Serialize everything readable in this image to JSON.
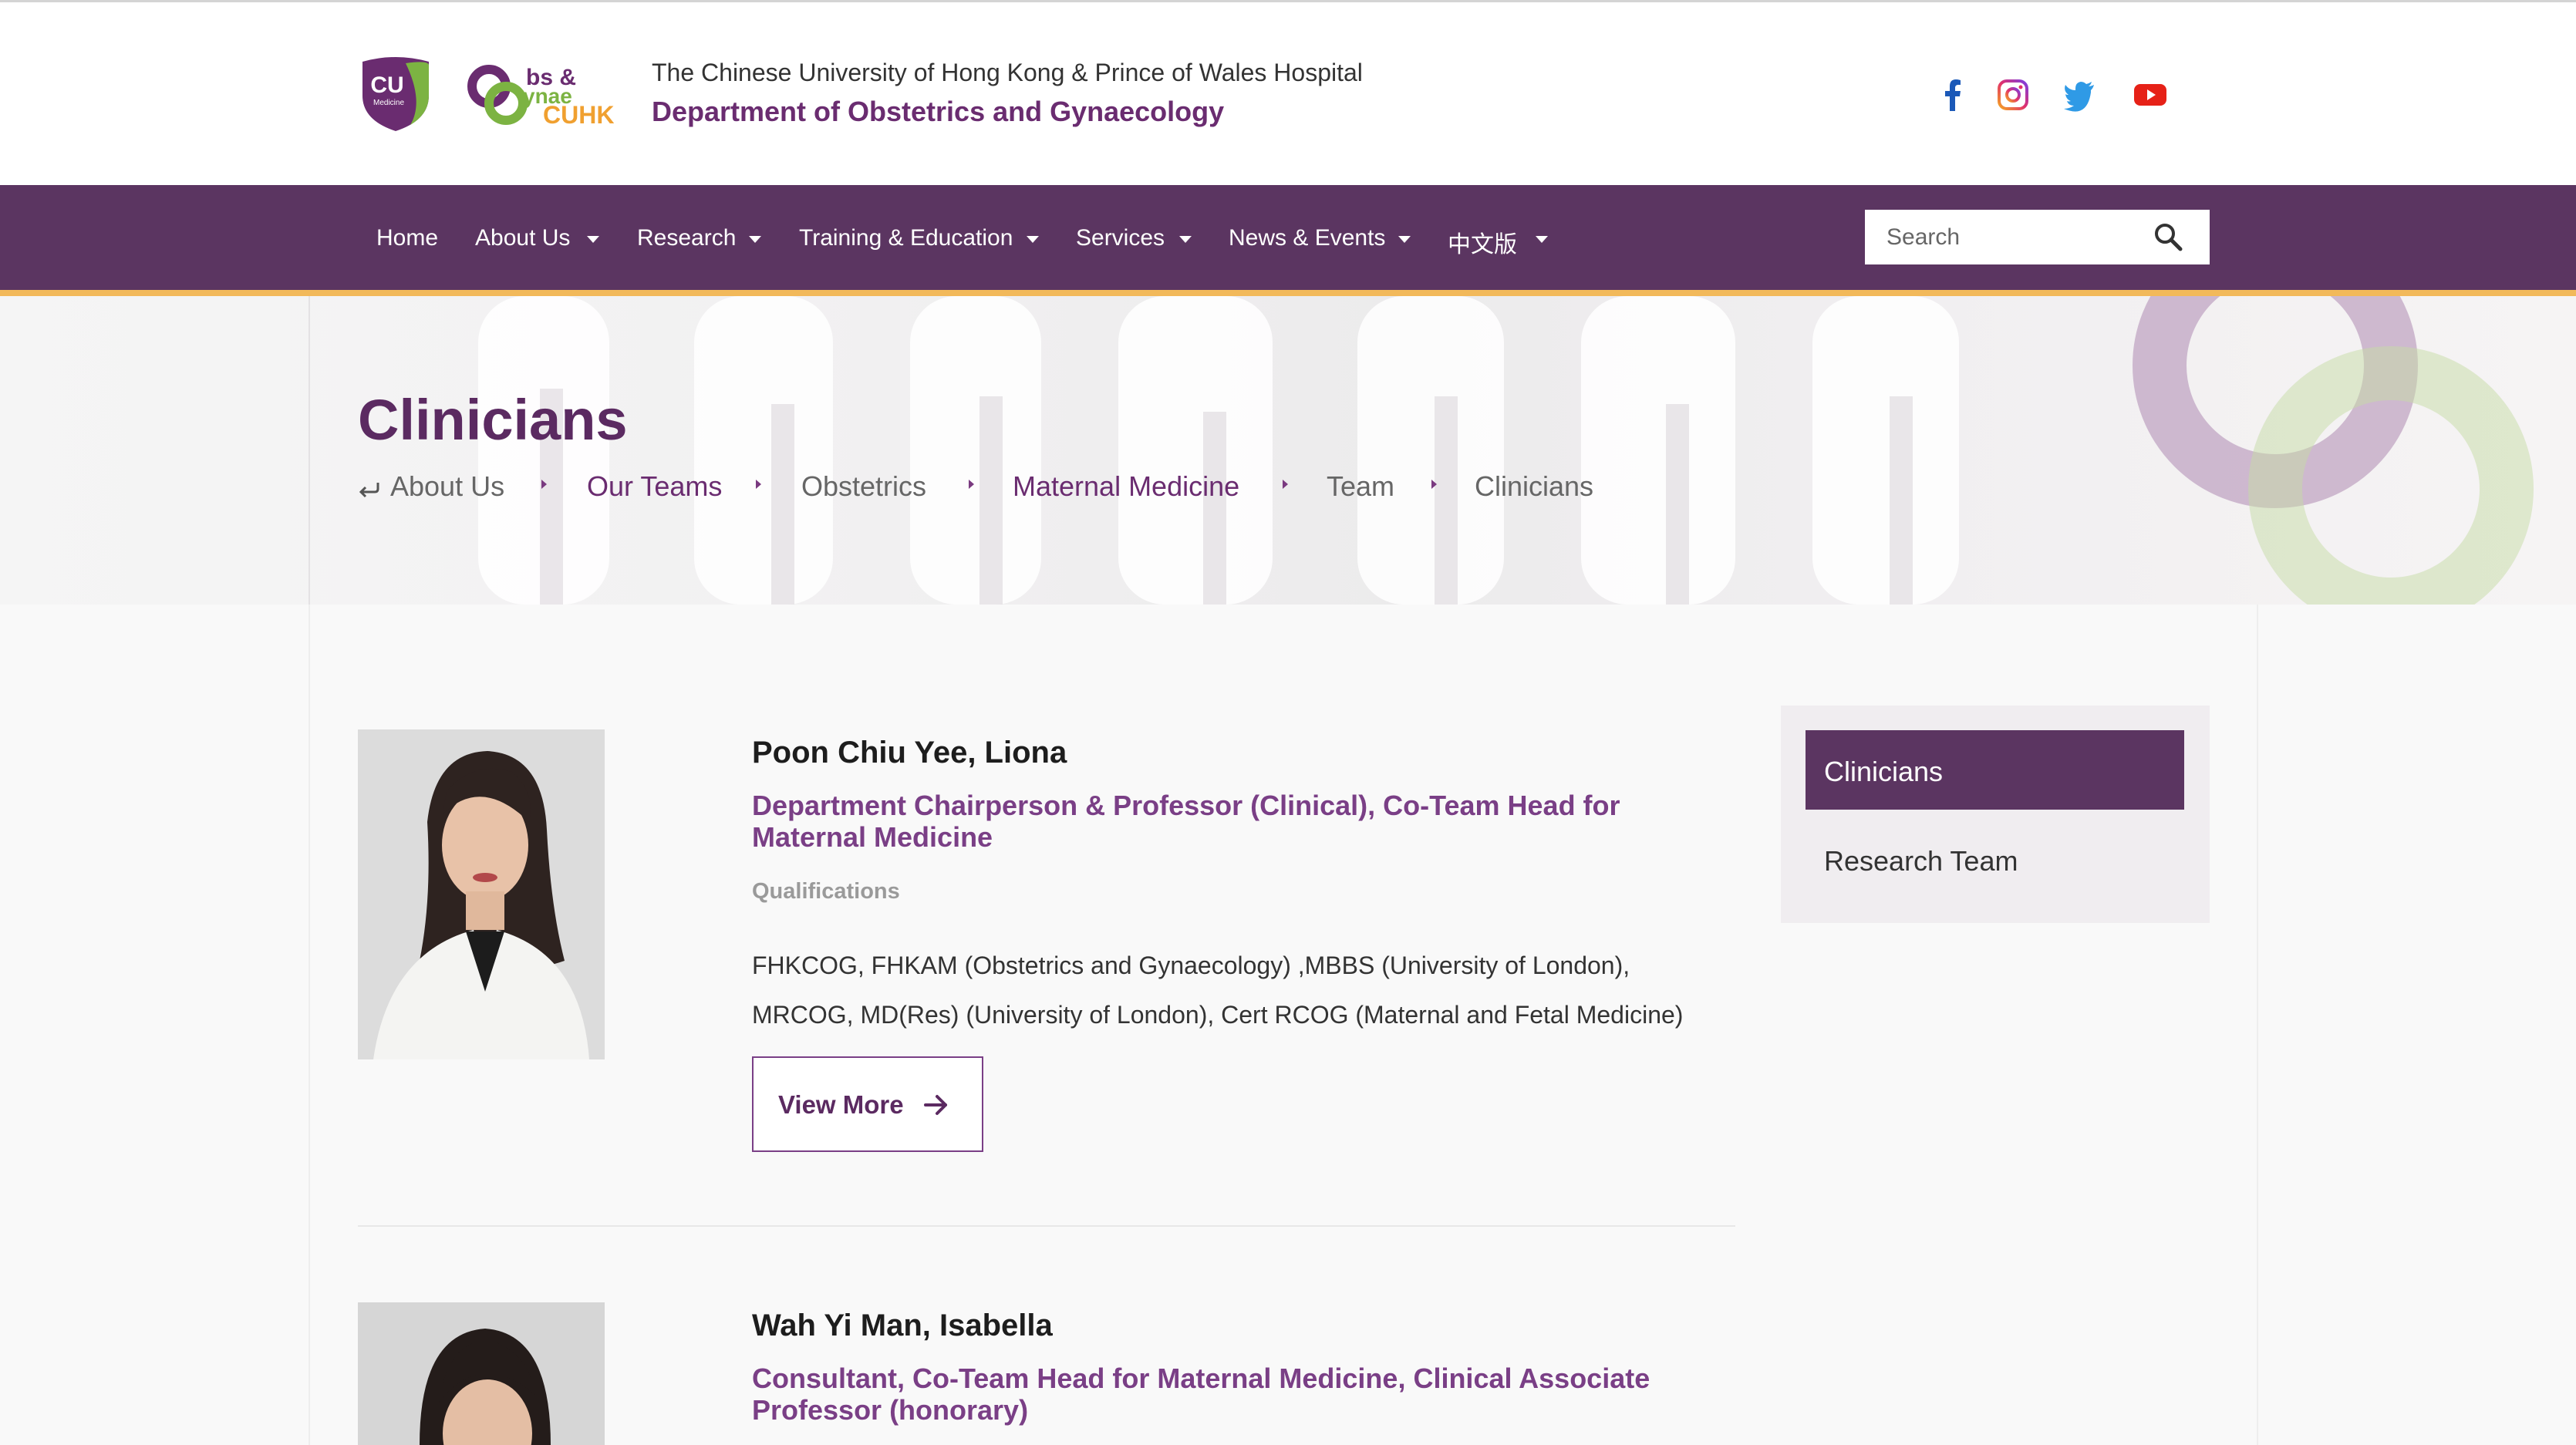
{
  "header": {
    "institution": "The Chinese University of Hong Kong & Prince of Wales Hospital",
    "department": "Department of Obstetrics and Gynaecology",
    "logo_cu_text": "CU",
    "logo_cu_sub": "Medicine",
    "logo_og_text": "bs & ynae CUHK",
    "social": [
      "facebook-icon",
      "instagram-icon",
      "twitter-icon",
      "youtube-icon"
    ]
  },
  "nav": {
    "items": [
      {
        "label": "Home",
        "has_dropdown": false
      },
      {
        "label": "About Us",
        "has_dropdown": true
      },
      {
        "label": "Research",
        "has_dropdown": true
      },
      {
        "label": "Training & Education",
        "has_dropdown": true
      },
      {
        "label": "Services",
        "has_dropdown": true
      },
      {
        "label": "News & Events",
        "has_dropdown": true
      },
      {
        "label": "中文版",
        "has_dropdown": true
      }
    ],
    "search_placeholder": "Search"
  },
  "banner": {
    "title": "Clinicians",
    "breadcrumb": [
      "About Us",
      "Our Teams",
      "Obstetrics",
      "Maternal Medicine",
      "Team",
      "Clinicians"
    ]
  },
  "people": [
    {
      "name": "Poon Chiu Yee, Liona",
      "role": "Department Chairperson & Professor (Clinical), Co-Team Head for Maternal Medicine",
      "qualifications_label": "Qualifications",
      "qualifications": "FHKCOG, FHKAM (Obstetrics and Gynaecology) ,MBBS (University of London), MRCOG, MD(Res) (University of London), Cert RCOG (Maternal and Fetal Medicine)",
      "button": "View More"
    },
    {
      "name": "Wah Yi Man, Isabella",
      "role": "Consultant, Co-Team Head for Maternal Medicine, Clinical Associate Professor (honorary)"
    }
  ],
  "sidebar": {
    "items": [
      "Clinicians",
      "Research Team"
    ]
  },
  "colors": {
    "brand_purple": "#5b3561",
    "accent_purple": "#7a3f86",
    "accent_gold": "#f2b95a"
  }
}
